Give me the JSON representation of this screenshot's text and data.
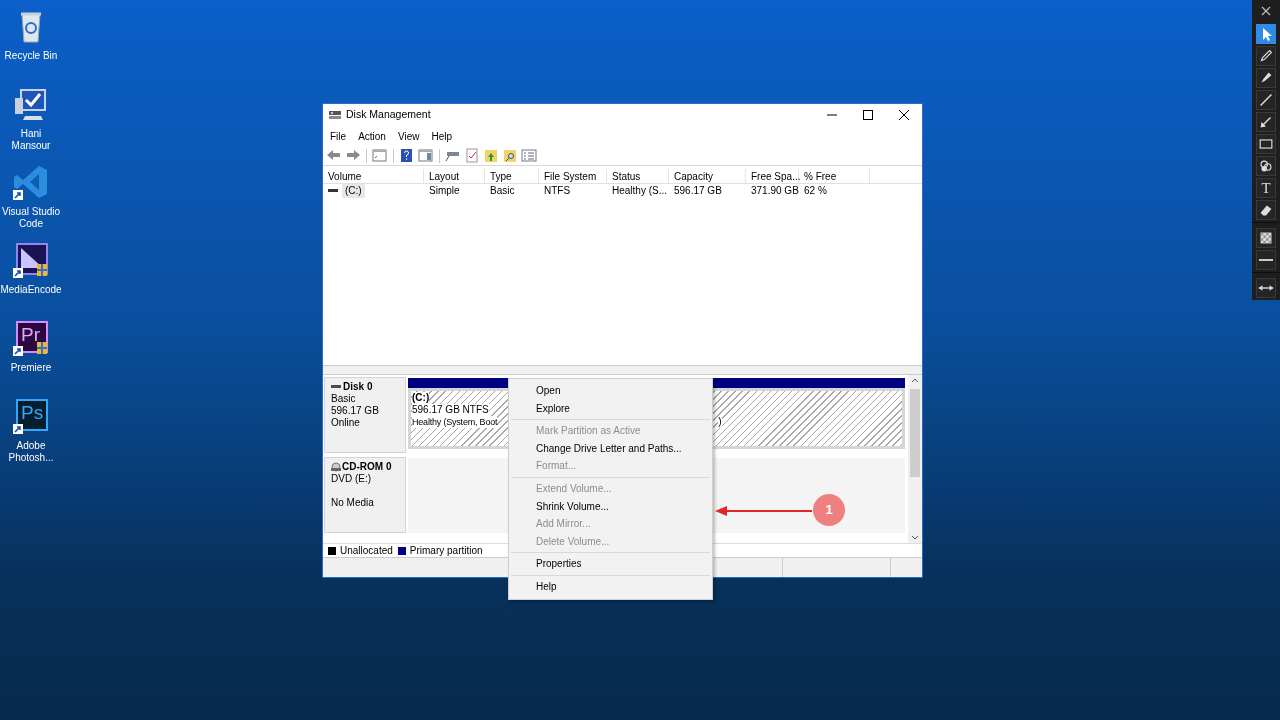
{
  "desktop_icons": [
    {
      "label": "Recycle Bin",
      "kind": "recycle",
      "shortcut": false
    },
    {
      "label": "Hani Mansour",
      "kind": "computer",
      "shortcut": false
    },
    {
      "label": "Visual Studio Code",
      "kind": "vscode",
      "shortcut": true
    },
    {
      "label": "MediaEncode",
      "kind": "mediaencode",
      "shortcut": true
    },
    {
      "label": "Premiere",
      "kind": "premiere",
      "shortcut": true,
      "glyph": "Pr"
    },
    {
      "label": "Adobe Photosh...",
      "kind": "photoshop",
      "shortcut": true,
      "glyph": "Ps"
    }
  ],
  "window": {
    "title": "Disk Management",
    "menu": [
      "File",
      "Action",
      "View",
      "Help"
    ],
    "toolbar": [
      {
        "kind": "back"
      },
      {
        "kind": "forward"
      },
      {
        "kind": "sep"
      },
      {
        "kind": "tree"
      },
      {
        "kind": "sep"
      },
      {
        "kind": "help"
      },
      {
        "kind": "pane"
      },
      {
        "kind": "sep"
      },
      {
        "kind": "connect"
      },
      {
        "kind": "check"
      },
      {
        "kind": "folder-up"
      },
      {
        "kind": "folder-search"
      },
      {
        "kind": "list"
      }
    ]
  },
  "volume_table": {
    "columns": [
      "Volume",
      "Layout",
      "Type",
      "File System",
      "Status",
      "Capacity",
      "Free Spa...",
      "% Free"
    ],
    "rows": [
      {
        "selected": true,
        "cells": [
          "(C:)",
          "Simple",
          "Basic",
          "NTFS",
          "Healthy (S...",
          "596.17 GB",
          "371.90 GB",
          "62 %"
        ]
      }
    ]
  },
  "disks": [
    {
      "kind": "disk",
      "name": "Disk 0",
      "lines": [
        "Basic",
        "596.17 GB",
        "Online"
      ],
      "partition": {
        "name": "(C:)",
        "size": "596.17 GB NTFS",
        "status": "Healthy (System, Boot",
        "status_tail": ")"
      }
    },
    {
      "kind": "cdrom",
      "name": "CD-ROM 0",
      "lines": [
        "DVD (E:)"
      ],
      "status": "No Media"
    }
  ],
  "legend": [
    {
      "label": "Unallocated",
      "color": "#000000"
    },
    {
      "label": "Primary partition",
      "color": "#000080"
    }
  ],
  "context_menu": [
    {
      "kind": "item",
      "label": "Open",
      "disabled": false
    },
    {
      "kind": "item",
      "label": "Explore",
      "disabled": false
    },
    {
      "kind": "separator"
    },
    {
      "kind": "item",
      "label": "Mark Partition as Active",
      "disabled": true
    },
    {
      "kind": "item",
      "label": "Change Drive Letter and Paths...",
      "disabled": false
    },
    {
      "kind": "item",
      "label": "Format...",
      "disabled": true
    },
    {
      "kind": "separator"
    },
    {
      "kind": "item",
      "label": "Extend Volume...",
      "disabled": true
    },
    {
      "kind": "item",
      "label": "Shrink Volume...",
      "disabled": false
    },
    {
      "kind": "item",
      "label": "Add Mirror...",
      "disabled": true
    },
    {
      "kind": "item",
      "label": "Delete Volume...",
      "disabled": true
    },
    {
      "kind": "separator"
    },
    {
      "kind": "item",
      "label": "Properties",
      "disabled": false
    },
    {
      "kind": "separator"
    },
    {
      "kind": "item",
      "label": "Help",
      "disabled": false
    }
  ],
  "annotation": {
    "badge": "1"
  },
  "tool_palette": [
    {
      "kind": "close",
      "selected": false
    },
    {
      "kind": "cursor",
      "selected": true
    },
    {
      "kind": "pencil",
      "selected": false
    },
    {
      "kind": "marker",
      "selected": false
    },
    {
      "kind": "line",
      "selected": false
    },
    {
      "kind": "arrow",
      "selected": false
    },
    {
      "kind": "rectangle",
      "selected": false
    },
    {
      "kind": "circles",
      "selected": false
    },
    {
      "kind": "text",
      "selected": false,
      "glyph": "T"
    },
    {
      "kind": "eraser",
      "selected": false
    },
    {
      "kind": "gap"
    },
    {
      "kind": "checker",
      "selected": false
    },
    {
      "kind": "dash",
      "selected": false
    },
    {
      "kind": "gap"
    },
    {
      "kind": "swap",
      "selected": false
    }
  ]
}
